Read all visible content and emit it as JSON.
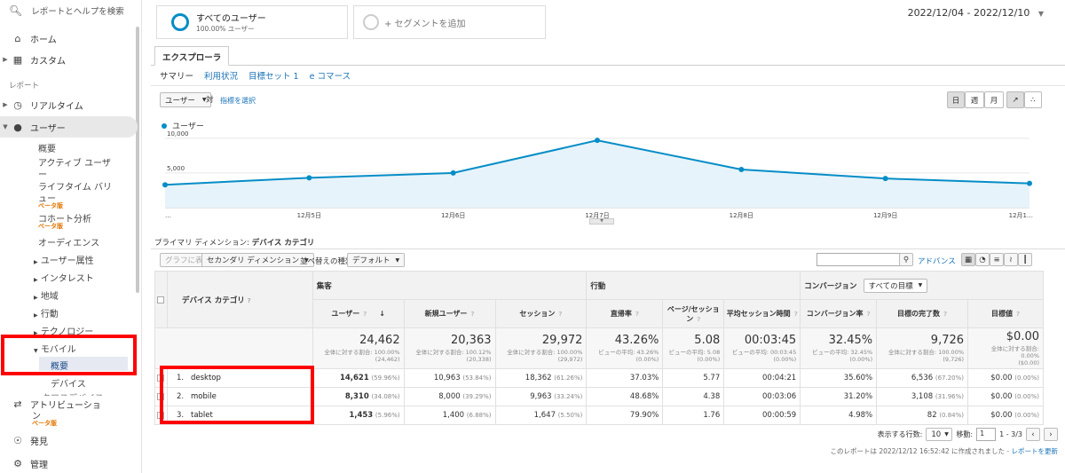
{
  "sidebar": {
    "search_placeholder": "レポートとヘルプを検索",
    "home": "ホーム",
    "custom": "カスタム",
    "reports_section": "レポート",
    "realtime": "リアルタイム",
    "users": "ユーザー",
    "users_sub": {
      "overview": "概要",
      "active1": "アクティブ ユーザ",
      "active2": "ー",
      "lifetime1": "ライフタイム バリ",
      "lifetime2": "ュー",
      "cohort": "コホート分析",
      "audience": "オーディエンス",
      "attributes": "ユーザー属性",
      "interest": "インタレスト",
      "geo": "地域",
      "behavior": "行動",
      "technology": "テクノロジー",
      "mobile": "モバイル",
      "mobile_overview": "概要",
      "devices": "デバイス",
      "cross_device": "クロスデバイス"
    },
    "beta": "ベータ版",
    "attribution1": "アトリビューショ",
    "attribution2": "ン",
    "discover": "発見",
    "admin": "管理"
  },
  "segments": {
    "all_users": "すべてのユーザー",
    "all_users_pct": "100.00% ユーザー",
    "add_segment": "+ セグメントを追加"
  },
  "date_range": "2022/12/04 - 2022/12/10",
  "explorer_tab": "エクスプローラ",
  "subtabs": [
    "サマリー",
    "利用状況",
    "目標セット 1",
    "e コマース"
  ],
  "metric_select": "ユーザー",
  "vs_label": "対",
  "select_metric": "指標を選択",
  "period_buttons": [
    "日",
    "週",
    "月"
  ],
  "chart_data": {
    "type": "area",
    "series": [
      {
        "name": "ユーザー",
        "values": [
          3300,
          4300,
          5000,
          9700,
          5500,
          4200,
          3500
        ]
      }
    ],
    "x": [
      "…",
      "12月5日",
      "12月6日",
      "12月7日",
      "12月8日",
      "12月9日",
      "12月1…"
    ],
    "y_ticks": [
      "10,000",
      "5,000"
    ],
    "ylim": [
      0,
      11000
    ],
    "color": "#058dc7"
  },
  "primary_dimension_label": "プライマリ ディメンション:",
  "primary_dimension_value": "デバイス カテゴリ",
  "controls": {
    "graph_view": "グラフに表示",
    "secondary_dim": "セカンダリ ディメンション",
    "sort_type": "並べ替えの種類:",
    "sort_default": "デフォルト",
    "advanced": "アドバンス"
  },
  "table": {
    "dim_header": "デバイス カテゴリ",
    "group_acquisition": "集客",
    "group_behavior": "行動",
    "group_conversion": "コンバージョン",
    "goal_select": "すべての目標",
    "columns": [
      "ユーザー",
      "新規ユーザー",
      "セッション",
      "直帰率",
      "ページ/セッション",
      "平均セッション時間",
      "コンバージョン率",
      "目標の完了数",
      "目標値"
    ],
    "totals": [
      {
        "v": "24,462",
        "s1": "全体に対する割合: 100.00%",
        "s2": "(24,462)"
      },
      {
        "v": "20,363",
        "s1": "全体に対する割合: 100.12%",
        "s2": "(20,338)"
      },
      {
        "v": "29,972",
        "s1": "全体に対する割合: 100.00%",
        "s2": "(29,972)"
      },
      {
        "v": "43.26%",
        "s1": "ビューの平均: 43.26%",
        "s2": "(0.00%)"
      },
      {
        "v": "5.08",
        "s1": "ビューの平均: 5.08",
        "s2": "(0.00%)"
      },
      {
        "v": "00:03:45",
        "s1": "ビューの平均: 00:03:45",
        "s2": "(0.00%)"
      },
      {
        "v": "32.45%",
        "s1": "ビューの平均: 32.45%",
        "s2": "(0.00%)"
      },
      {
        "v": "9,726",
        "s1": "全体に対する割合: 100.00%",
        "s2": "(9,726)"
      },
      {
        "v": "$0.00",
        "s1": "全体に対する割合: 0.00%",
        "s2": "($0.00)"
      }
    ],
    "rows": [
      {
        "n": "1.",
        "name": "desktop",
        "cells": [
          [
            "14,621",
            "(59.96%)"
          ],
          [
            "10,963",
            "(53.84%)"
          ],
          [
            "18,362",
            "(61.26%)"
          ],
          [
            "37.03%",
            ""
          ],
          [
            "5.77",
            ""
          ],
          [
            "00:04:21",
            ""
          ],
          [
            "35.60%",
            ""
          ],
          [
            "6,536",
            "(67.20%)"
          ],
          [
            "$0.00",
            "(0.00%)"
          ]
        ]
      },
      {
        "n": "2.",
        "name": "mobile",
        "cells": [
          [
            "8,310",
            "(34.08%)"
          ],
          [
            "8,000",
            "(39.29%)"
          ],
          [
            "9,963",
            "(33.24%)"
          ],
          [
            "48.68%",
            ""
          ],
          [
            "4.38",
            ""
          ],
          [
            "00:03:06",
            ""
          ],
          [
            "31.20%",
            ""
          ],
          [
            "3,108",
            "(31.96%)"
          ],
          [
            "$0.00",
            "(0.00%)"
          ]
        ]
      },
      {
        "n": "3.",
        "name": "tablet",
        "cells": [
          [
            "1,453",
            "(5.96%)"
          ],
          [
            "1,400",
            "(6.88%)"
          ],
          [
            "1,647",
            "(5.50%)"
          ],
          [
            "79.90%",
            ""
          ],
          [
            "1.76",
            ""
          ],
          [
            "00:00:59",
            ""
          ],
          [
            "4.98%",
            ""
          ],
          [
            "82",
            "(0.84%)"
          ],
          [
            "$0.00",
            "(0.00%)"
          ]
        ]
      }
    ]
  },
  "pagination": {
    "rows_label": "表示する行数:",
    "rows_value": "10",
    "goto_label": "移動:",
    "goto_value": "1",
    "range": "1 - 3/3"
  },
  "report_footer": "このレポートは 2022/12/12 16:52:42 に作成されました -",
  "refresh_report": "レポートを更新"
}
